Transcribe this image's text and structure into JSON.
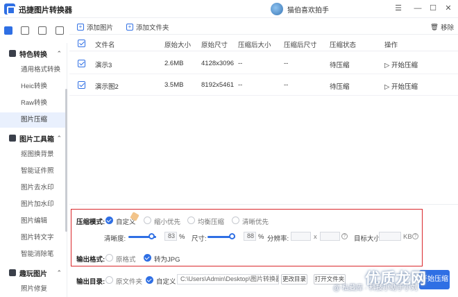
{
  "app": {
    "title": "迅捷图片转换器",
    "username": "猫伯喜欢拍手"
  },
  "window": {
    "menu_icon": "menu-icon",
    "minimize": "minimize-icon",
    "maximize": "maximize-icon",
    "close": "close-icon"
  },
  "sidebar": {
    "groups": [
      {
        "label": "特色转换",
        "items": [
          "通用格式转换",
          "Heic转换",
          "Raw转换",
          "图片压缩"
        ]
      },
      {
        "label": "图片工具箱",
        "items": [
          "抠图换背景",
          "智能证件照",
          "图片去水印",
          "图片加水印",
          "图片编辑",
          "图片转文字",
          "智能消除笔"
        ]
      },
      {
        "label": "趣玩图片",
        "items": [
          "照片修复"
        ]
      }
    ],
    "active_item": "图片压缩"
  },
  "toolbar": {
    "add_image": "添加图片",
    "add_folder": "添加文件夹",
    "remove": "移除"
  },
  "table": {
    "columns": [
      "文件名",
      "原始大小",
      "原始尺寸",
      "压缩后大小",
      "压缩后尺寸",
      "压缩状态",
      "操作"
    ],
    "rows": [
      {
        "name": "演示3",
        "size": "2.6MB",
        "dims": "4128x3096",
        "new_size": "--",
        "new_dims": "--",
        "status": "待压缩",
        "action": "开始压缩"
      },
      {
        "name": "演示图2",
        "size": "3.5MB",
        "dims": "8192x5461",
        "new_size": "--",
        "new_dims": "--",
        "status": "待压缩",
        "action": "开始压缩"
      }
    ]
  },
  "settings": {
    "mode_label": "压缩模式:",
    "modes": [
      "自定义",
      "缩小优先",
      "均衡压缩",
      "清晰优先"
    ],
    "selected_mode": "自定义",
    "clarity_label": "清晰度:",
    "clarity_value": "83",
    "size_label": "尺寸:",
    "size_value": "88",
    "percent": "%",
    "resolution_label": "分辨率:",
    "times": "x",
    "target_label": "目标大小:",
    "target_unit": "KB",
    "clarity_fraction": 0.83,
    "size_fraction": 0.88,
    "format_label": "输出格式:",
    "formats": [
      "原格式",
      "转为JPG"
    ],
    "selected_format": "转为JPG",
    "output_label": "输出目录:",
    "output_options": [
      "原文件夹",
      "自定义"
    ],
    "selected_output": "自定义",
    "output_path": "C:\\Users\\Admin\\Desktop\\图片转换器",
    "change_dir": "更改目录",
    "open_folder": "打开文件夹",
    "start_all": "开始压缩"
  },
  "watermark": {
    "main": "优质龙网",
    "sub": "@ 私藏库 · 科技小助手小刘"
  },
  "colors": {
    "accent": "#2f6fe4",
    "highlight_box": "#d9262a",
    "active_bg": "#e9f0fd"
  }
}
